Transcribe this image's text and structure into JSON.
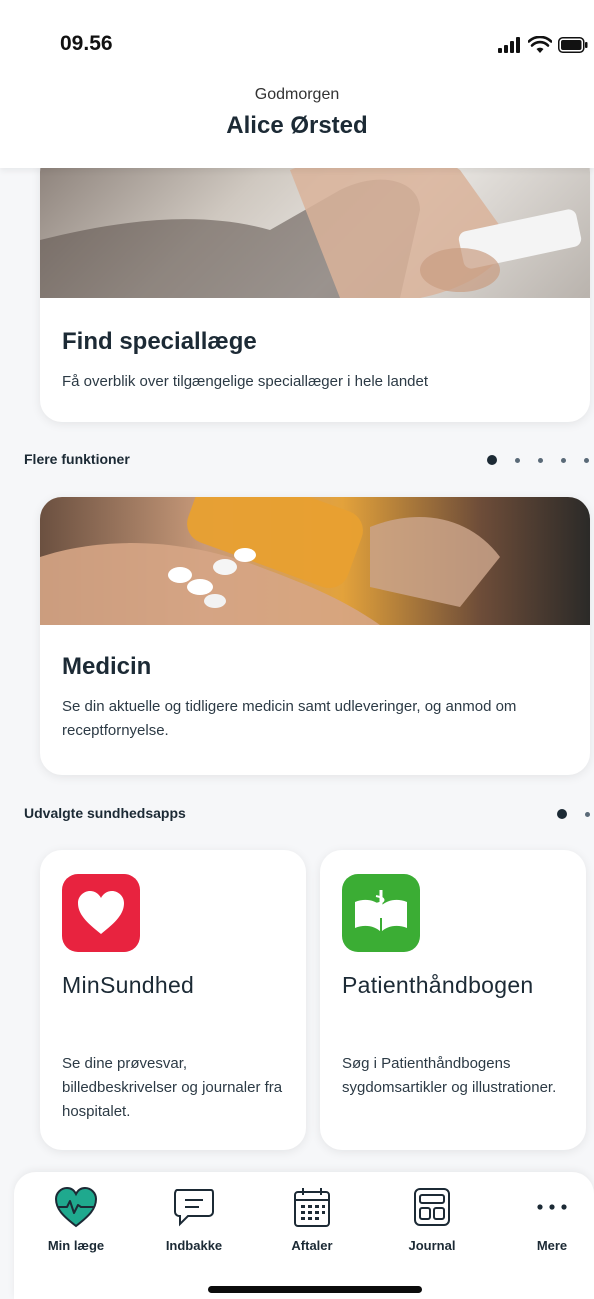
{
  "status_bar": {
    "time": "09.56"
  },
  "header": {
    "greeting": "Godmorgen",
    "user_name": "Alice Ørsted"
  },
  "cards": {
    "find_specialist": {
      "title": "Find speciallæge",
      "description": "Få overblik over tilgængelige speciallæger i hele landet"
    },
    "medicine": {
      "title": "Medicin",
      "description": "Se din aktuelle og tidligere medicin samt udleveringer, og anmod om receptfornyelse."
    }
  },
  "sections": {
    "more_functions": {
      "label": "Flere funktioner",
      "page_count": 5,
      "active_page": 1
    },
    "selected_apps": {
      "label": "Udvalgte sundhedsapps",
      "page_count": 2,
      "active_page": 1
    }
  },
  "apps": [
    {
      "name": "MinSundhed",
      "description": "Se dine prøvesvar, billedbeskrivelser og journaler fra hospitalet.",
      "icon": "heart-icon",
      "color": "#e8233f"
    },
    {
      "name": "Patienthåndbogen",
      "description": "Søg i Patienthåndbogens sygdomsartikler og illustrationer.",
      "icon": "book-icon",
      "color": "#3bad34"
    }
  ],
  "tabbar": {
    "items": [
      {
        "label": "Min læge",
        "icon": "heart-pulse-icon",
        "active": true
      },
      {
        "label": "Indbakke",
        "icon": "message-icon",
        "active": false
      },
      {
        "label": "Aftaler",
        "icon": "calendar-icon",
        "active": false
      },
      {
        "label": "Journal",
        "icon": "journal-icon",
        "active": false
      },
      {
        "label": "Mere",
        "icon": "more-icon",
        "active": false
      }
    ]
  },
  "colors": {
    "accent": "#1fa98e",
    "text": "#1c2a35",
    "background": "#f6f7f9"
  }
}
